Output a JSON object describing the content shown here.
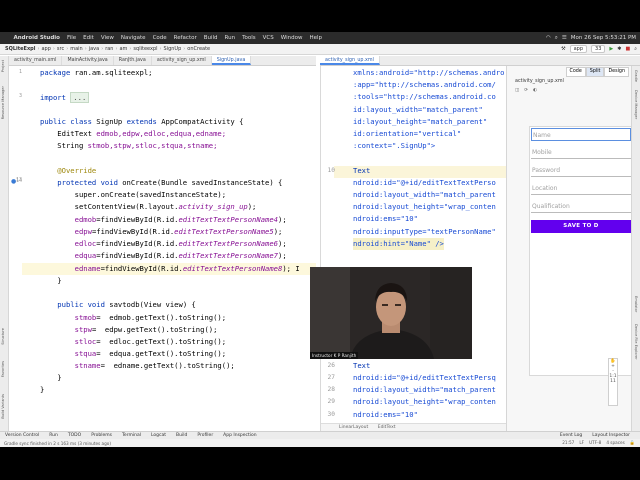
{
  "menubar": {
    "app": "Android Studio",
    "items": [
      "File",
      "Edit",
      "View",
      "Navigate",
      "Code",
      "Refactor",
      "Build",
      "Run",
      "Tools",
      "VCS",
      "Window",
      "Help"
    ],
    "clock": "Mon 26 Sep  5:53:21 PM"
  },
  "breadcrumb": [
    "SQLiteExpl",
    "app",
    "src",
    "main",
    "java",
    "ran",
    "am",
    "sqliteexpl",
    "SignUp",
    "onCreate"
  ],
  "toolbar": {
    "device": "app",
    "api": "33"
  },
  "tabs_left": [
    {
      "label": "activity_main.xml",
      "active": false
    },
    {
      "label": "MainActivity.java",
      "active": false
    },
    {
      "label": "RanJth.java",
      "active": false
    },
    {
      "label": "activity_sign_up.xml",
      "active": false
    },
    {
      "label": "SignUp.java",
      "active": true
    }
  ],
  "tabs_right": [
    {
      "label": "activity_sign_up.xml",
      "active": true
    }
  ],
  "left_strip": [
    "Project",
    "Resource Manager",
    "Structure",
    "Favorites",
    "Build Variants"
  ],
  "right_strip": [
    "Gradle",
    "Device Manager",
    "Emulator",
    "Device File Explorer"
  ],
  "editor_left": {
    "line_numbers": [
      "1",
      "3",
      "",
      "",
      "",
      "",
      "",
      "13",
      "14",
      "15",
      "16",
      "17",
      "18",
      "19",
      "20",
      "21",
      "22",
      "23",
      "",
      "",
      "",
      "",
      "",
      "",
      "",
      "",
      ""
    ],
    "package_kw": "package",
    "package_name": " ran.am.sqliteexpl;",
    "import_kw": "import",
    "import_fold": "...",
    "class_line": {
      "mods": "public class ",
      "name": "SignUp ",
      "ext": "extends ",
      "parent": "AppCompatActivity {"
    },
    "fields1": {
      "type": "    EditText ",
      "vars": "edmob,edpw,edloc,edqua,edname;"
    },
    "fields2": {
      "type": "    String ",
      "vars": "stmob,stpw,stloc,stqua,stname;"
    },
    "override": "    @Override",
    "oncreate": {
      "mods": "    protected void ",
      "rest": "onCreate(Bundle savedInstanceState) {"
    },
    "super_call": "        super.onCreate(savedInstanceState);",
    "content_view": {
      "a": "        setContentView(R.layout.",
      "b": "activity_sign_up",
      "c": ");"
    },
    "finds": [
      {
        "v": "        edmob",
        "a": "=findViewById(R.id.",
        "id": "editTextTextPersonName4",
        "c": ");"
      },
      {
        "v": "        edpw",
        "a": "=findViewById(R.id.",
        "id": "editTextTextPersonName5",
        "c": ");"
      },
      {
        "v": "        edloc",
        "a": "=findViewById(R.id.",
        "id": "editTextTextPersonName6",
        "c": ");"
      },
      {
        "v": "        edqua",
        "a": "=findViewById(R.id.",
        "id": "editTextTextPersonName7",
        "c": ");"
      },
      {
        "v": "        edname",
        "a": "=findViewById(R.id.",
        "id": "editTextTextPersonName8",
        "c": "); I"
      }
    ],
    "close1": "    }",
    "savtodb": {
      "mods": "    public void ",
      "rest": "savtodb(View view) {"
    },
    "gets": [
      {
        "v": "        stmob",
        "a": "=  edmob.getText().toString();"
      },
      {
        "v": "        stpw",
        "a": "=  edpw.getText().toString();"
      },
      {
        "v": "        stloc",
        "a": "=  edloc.getText().toString();"
      },
      {
        "v": "        stqua",
        "a": "=  edqua.getText().toString();"
      },
      {
        "v": "        stname",
        "a": "=  edname.getText().toString();"
      }
    ],
    "close2": "    }",
    "close3": "}"
  },
  "editor_right": {
    "lines": [
      {
        "n": "",
        "t": "xmlns:android=\"http://schemas.andro"
      },
      {
        "n": "",
        "t": ":app=\"http://schemas.android.com/"
      },
      {
        "n": "",
        "t": ":tools=\"http://schemas.android.co"
      },
      {
        "n": "",
        "t": "id:layout_width=\"match_parent\""
      },
      {
        "n": "",
        "t": "id:layout_height=\"match_parent\""
      },
      {
        "n": "",
        "t": "id:orientation=\"vertical\""
      },
      {
        "n": "",
        "t": ":context=\".SignUp\">"
      },
      {
        "n": "",
        "t": ""
      },
      {
        "n": "10",
        "t": "Text"
      },
      {
        "n": "",
        "t": "ndroid:id=\"@+id/editTextTextPerso"
      },
      {
        "n": "",
        "t": "ndroid:layout_width=\"match_parent"
      },
      {
        "n": "",
        "t": "ndroid:layout_height=\"wrap_conten"
      },
      {
        "n": "",
        "t": "ndroid:ems=\"10\""
      },
      {
        "n": "",
        "t": "ndroid:inputType=\"textPersonName\""
      },
      {
        "n": "",
        "t": "ndroid:hint=\"Name\" />"
      },
      {
        "n": "",
        "t": ""
      },
      {
        "n": "",
        "t": ""
      },
      {
        "n": "",
        "t": "tP"
      },
      {
        "n": "",
        "t": "t_parent"
      },
      {
        "n": "",
        "t": "_parent"
      },
      {
        "n": "",
        "t": ""
      },
      {
        "n": "",
        "t": "Name\""
      },
      {
        "n": "",
        "t": ""
      },
      {
        "n": "",
        "t": ""
      },
      {
        "n": "26",
        "t": "Text"
      },
      {
        "n": "27",
        "t": "ndroid:id=\"@+id/editTextTextPersq"
      },
      {
        "n": "28",
        "t": "ndroid:layout_width=\"match_parent"
      },
      {
        "n": "29",
        "t": "ndroid:layout_height=\"wrap_conten"
      },
      {
        "n": "30",
        "t": "ndroid:ems=\"10\""
      }
    ],
    "footer": [
      "LinearLayout",
      "EditText"
    ]
  },
  "design": {
    "view_modes": [
      "Code",
      "Split",
      "Design"
    ],
    "active_mode": "Split",
    "file_tab": "activity_sign_up.xml",
    "fields": [
      "Name",
      "Mobile",
      "Password",
      "Location",
      "Qualification"
    ],
    "button": "SAVE TO D",
    "zoom_tools": [
      "+",
      "-",
      "1:1",
      "11"
    ]
  },
  "bottom_tools": [
    "Version Control",
    "Run",
    "TODO",
    "Problems",
    "Terminal",
    "Logcat",
    "Build",
    "Profiler",
    "App Inspection"
  ],
  "bottom_tools_right": [
    "Event Log",
    "Layout Inspector"
  ],
  "status": {
    "message": "Gradle sync finished in 2 s 163 ms (3 minutes ago)",
    "position": "21:57",
    "line_sep": "LF",
    "encoding": "UTF-8",
    "indent": "4 spaces"
  },
  "webcam": {
    "label": "Instructor   K P Ranjith"
  },
  "colors": {
    "accent": "#6200ee",
    "tab_active": "#2a5db0"
  }
}
